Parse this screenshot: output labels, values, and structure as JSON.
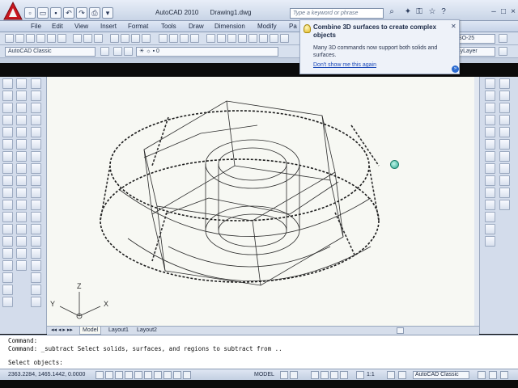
{
  "app": {
    "title": "AutoCAD 2010",
    "document": "Drawing1.dwg",
    "search_placeholder": "Type a keyword or phrase"
  },
  "menu": [
    "File",
    "Edit",
    "View",
    "Insert",
    "Format",
    "Tools",
    "Draw",
    "Dimension",
    "Modify",
    "Pa"
  ],
  "toolbar": {
    "workspace": "AutoCAD Classic",
    "layer": "0",
    "dimstyle": "ISO-25",
    "linetype": "ByLayer"
  },
  "balloon": {
    "title": "Combine 3D surfaces to create complex objects",
    "body": "Many 3D commands now support both solids and surfaces.",
    "link": "Don't show me this again"
  },
  "drawing": {
    "ucs_x": "X",
    "ucs_y": "Y",
    "ucs_z": "Z"
  },
  "tabs": [
    "Model",
    "Layout1",
    "Layout2"
  ],
  "command": {
    "line1": "Command:",
    "line2": "Command: _subtract Select solids, surfaces, and regions to subtract from ..",
    "line3": "Select objects:"
  },
  "status": {
    "coords": "2363.2284, 1465.1442, 0.0000",
    "model": "MODEL",
    "scale": "1:1",
    "workspace": "AutoCAD Classic"
  },
  "colors": {
    "accent": "#2a6ad0",
    "grip": "#2aa890",
    "logo": "#c8161e"
  }
}
